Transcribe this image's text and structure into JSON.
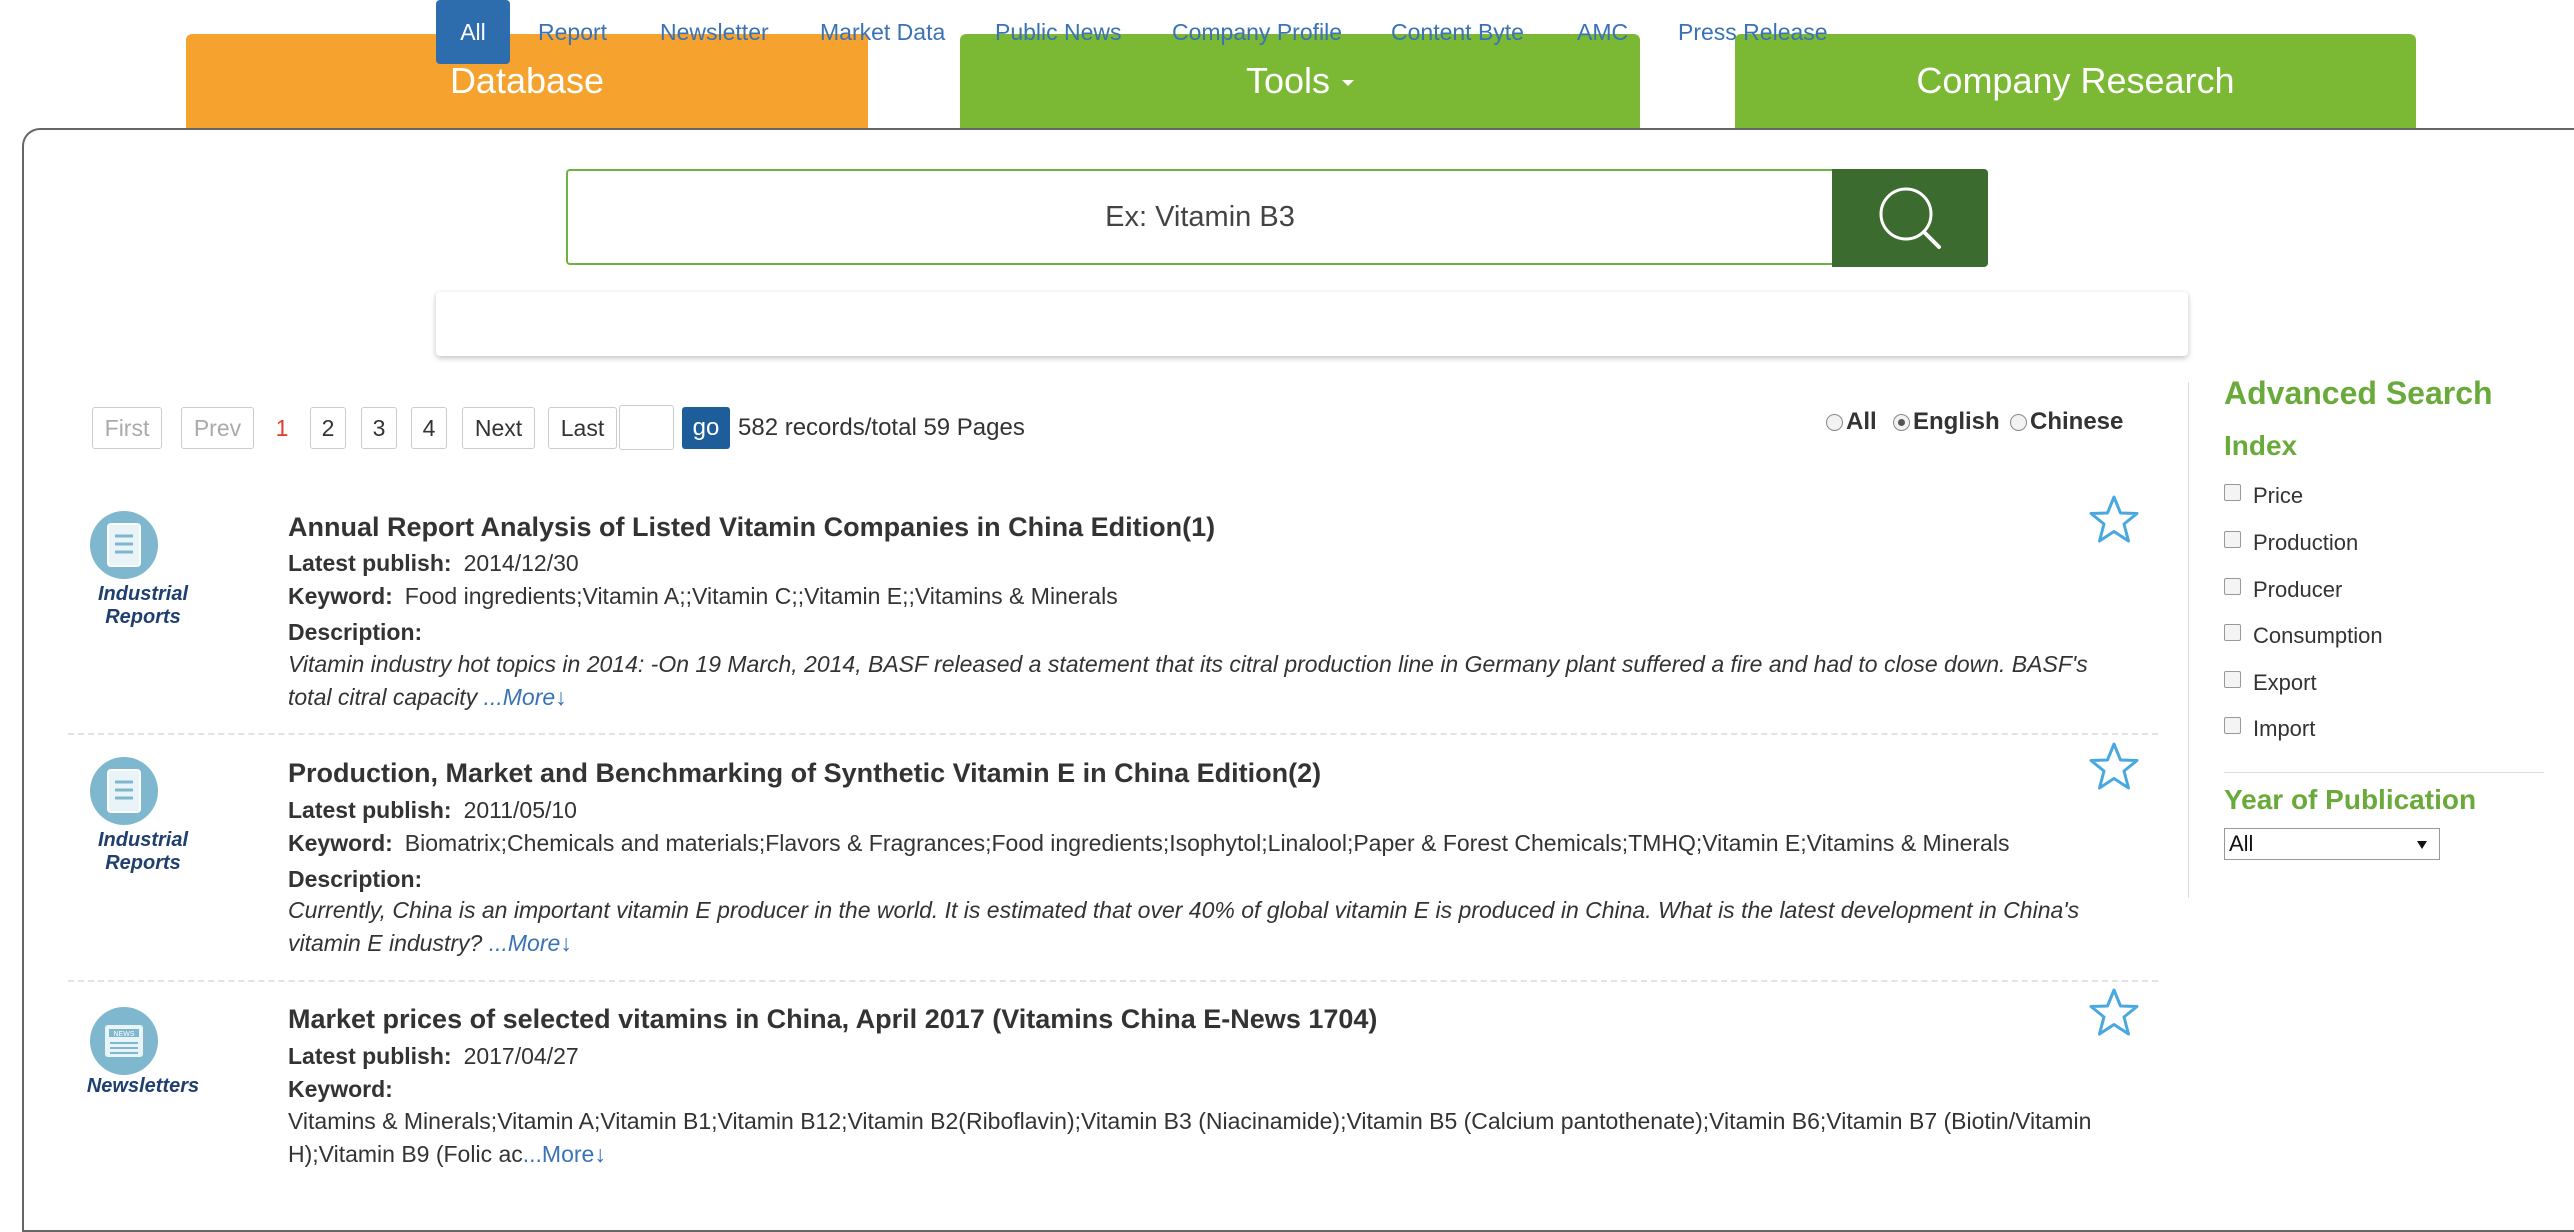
{
  "top_tabs": {
    "database": "Database",
    "tools": "Tools",
    "company_research": "Company Research"
  },
  "search": {
    "placeholder": "Ex: Vitamin B3",
    "button_icon": "search-icon"
  },
  "categories": [
    "All",
    "Report",
    "Newsletter",
    "Market Data",
    "Public News",
    "Company Profile",
    "Content Byte",
    "AMC",
    "Press Release"
  ],
  "pagination": {
    "first": "First",
    "prev": "Prev",
    "current": "1",
    "pages": [
      "2",
      "3",
      "4"
    ],
    "next": "Next",
    "last": "Last",
    "go": "go",
    "summary": "582 records/total 59 Pages"
  },
  "language": {
    "options": [
      "All",
      "English",
      "Chinese"
    ],
    "selected": "English"
  },
  "results": [
    {
      "type_label_1": "Industrial",
      "type_label_2": "Reports",
      "type_icon": "report-icon",
      "title": "Annual Report Analysis of Listed Vitamin Companies in China Edition(1)",
      "publish_label": "Latest publish:",
      "publish_date": "2014/12/30",
      "keyword_label": "Keyword:",
      "keywords": "Food ingredients;Vitamin A;;Vitamin C;;Vitamin E;;Vitamins & Minerals",
      "description_label": "Description:",
      "description": "Vitamin industry hot topics in 2014: -On 19 March, 2014, BASF released a statement that its citral production line in Germany plant suffered a fire and had to close down. BASF's total citral capacity",
      "more": "...More↓"
    },
    {
      "type_label_1": "Industrial",
      "type_label_2": "Reports",
      "type_icon": "report-icon",
      "title": "Production, Market and Benchmarking of Synthetic Vitamin E in China Edition(2)",
      "publish_label": "Latest publish:",
      "publish_date": "2011/05/10",
      "keyword_label": "Keyword:",
      "keywords": "Biomatrix;Chemicals and materials;Flavors & Fragrances;Food ingredients;Isophytol;Linalool;Paper & Forest Chemicals;TMHQ;Vitamin E;Vitamins & Minerals",
      "description_label": "Description:",
      "description": "Currently, China is an important vitamin E producer in the world. It is estimated that over 40% of global vitamin E is produced in China. What is the latest development in China's vitamin E industry?",
      "more": "...More↓"
    },
    {
      "type_label_1": "Newsletters",
      "type_icon": "newsletter-icon",
      "title": "Market prices of selected vitamins in China, April 2017 (Vitamins China E-News 1704)",
      "publish_label": "Latest publish:",
      "publish_date": "2017/04/27",
      "keyword_label": "Keyword:",
      "keywords": "Vitamins & Minerals;Vitamin A;Vitamin B1;Vitamin B12;Vitamin B2(Riboflavin);Vitamin B3 (Niacinamide);Vitamin B5 (Calcium pantothenate);Vitamin B6;Vitamin B7 (Biotin/Vitamin H);Vitamin B9 (Folic ac",
      "more": "...More↓"
    }
  ],
  "sidebar": {
    "advanced_search": "Advanced Search",
    "index_title": "Index",
    "index_options": [
      "Price",
      "Production",
      "Producer",
      "Consumption",
      "Export",
      "Import"
    ],
    "year_title": "Year of Publication",
    "year_selected": "All"
  },
  "colors": {
    "database_tab": "#f5a22f",
    "green_tab": "#7bb833",
    "search_button": "#3b6b2f",
    "active_category": "#2d6cad",
    "sidebar_heading": "#6aaa3a"
  }
}
